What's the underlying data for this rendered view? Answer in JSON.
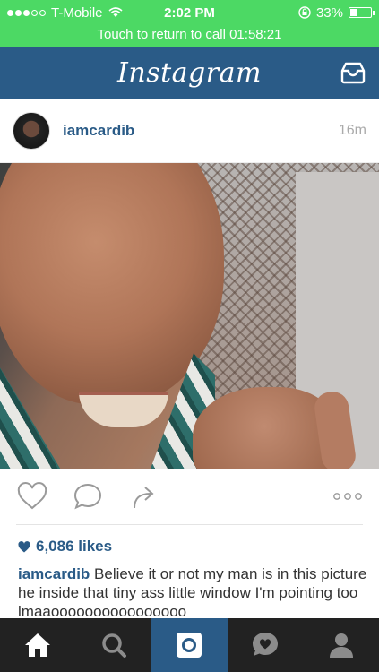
{
  "status_bar": {
    "carrier": "T-Mobile",
    "time": "2:02 PM",
    "battery": "33%",
    "battery_level": 0.33
  },
  "call_banner": {
    "text": "Touch to return to call",
    "duration": "01:58:21"
  },
  "header": {
    "logo": "Instagram",
    "inbox_icon": "inbox-icon"
  },
  "post": {
    "username": "iamcardib",
    "time_ago": "16m",
    "likes": "6,086 likes",
    "caption_user": "iamcardib",
    "caption_text": "Believe it or not my man is in this picture he inside that tiny ass little window I'm pointing too lmaaoooooooooooooooo"
  },
  "actions": {
    "icons": [
      "heart-icon",
      "comment-icon",
      "share-icon",
      "more-icon"
    ]
  },
  "tab_bar": {
    "items": [
      "home-icon",
      "search-icon",
      "camera-icon",
      "activity-icon",
      "profile-icon"
    ],
    "active": "camera-icon"
  },
  "colors": {
    "status_green": "#4cd964",
    "brand_blue": "#2a5b87",
    "tab_bar_bg": "#222222"
  }
}
